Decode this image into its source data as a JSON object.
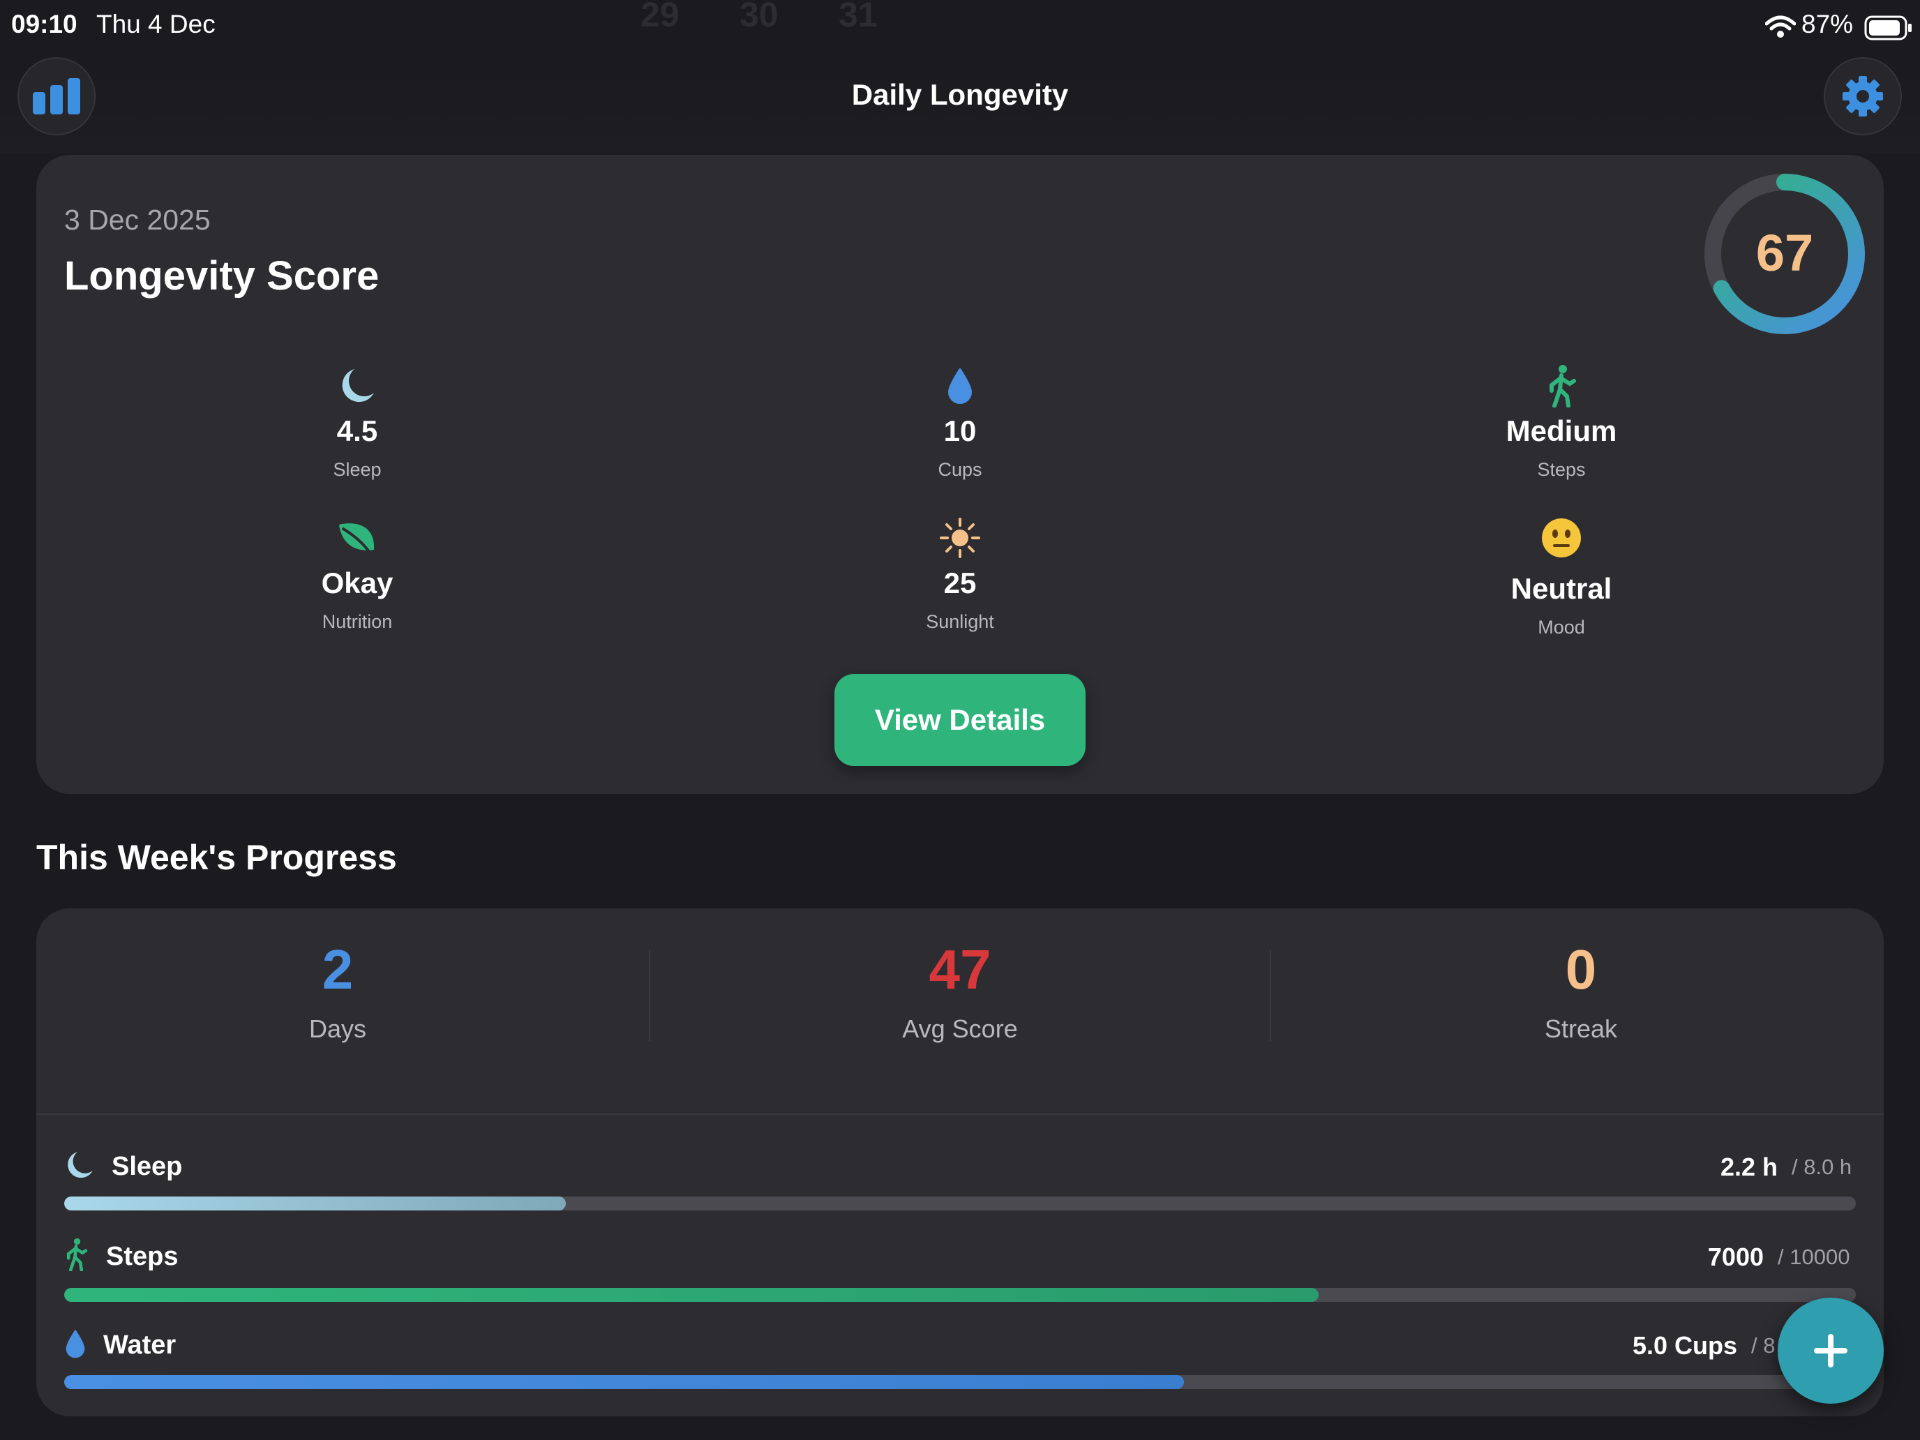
{
  "status_bar": {
    "time": "09:10",
    "date": "Thu 4 Dec",
    "battery": "87%",
    "faded_dates": [
      "29",
      "30",
      "31"
    ]
  },
  "nav": {
    "title": "Daily Longevity",
    "stats_icon": "bar-chart-icon",
    "settings_icon": "gear-icon"
  },
  "score_card": {
    "date": "3 Dec 2025",
    "title": "Longevity Score",
    "score": "67",
    "score_fraction": 0.67,
    "metrics": [
      {
        "value": "4.5",
        "label": "Sleep",
        "icon": "moon-icon"
      },
      {
        "value": "10",
        "label": "Cups",
        "icon": "water-drop-icon"
      },
      {
        "value": "Medium",
        "label": "Steps",
        "icon": "walking-icon"
      },
      {
        "value": "Okay",
        "label": "Nutrition",
        "icon": "leaf-icon"
      },
      {
        "value": "25",
        "label": "Sunlight",
        "icon": "sun-icon"
      },
      {
        "value": "Neutral",
        "label": "Mood",
        "icon": "neutral-face-icon"
      }
    ],
    "button": "View Details"
  },
  "week": {
    "title": "This Week's Progress",
    "stats": [
      {
        "value": "2",
        "label": "Days",
        "color": "#4a90e2"
      },
      {
        "value": "47",
        "label": "Avg Score",
        "color": "#d9383a"
      },
      {
        "value": "0",
        "label": "Streak",
        "color": "#f5c08a"
      }
    ],
    "progress": [
      {
        "label": "Sleep",
        "value": "2.2 h",
        "goal": "/ 8.0 h",
        "fraction": 0.28,
        "icon": "moon-icon"
      },
      {
        "label": "Steps",
        "value": "7000",
        "goal": "/ 10000",
        "fraction": 0.7,
        "icon": "walking-icon"
      },
      {
        "label": "Water",
        "value": "5.0 Cups",
        "goal": "/ 8",
        "fraction": 0.625,
        "icon": "water-drop-icon"
      }
    ]
  },
  "fab": {
    "icon": "plus-icon"
  }
}
